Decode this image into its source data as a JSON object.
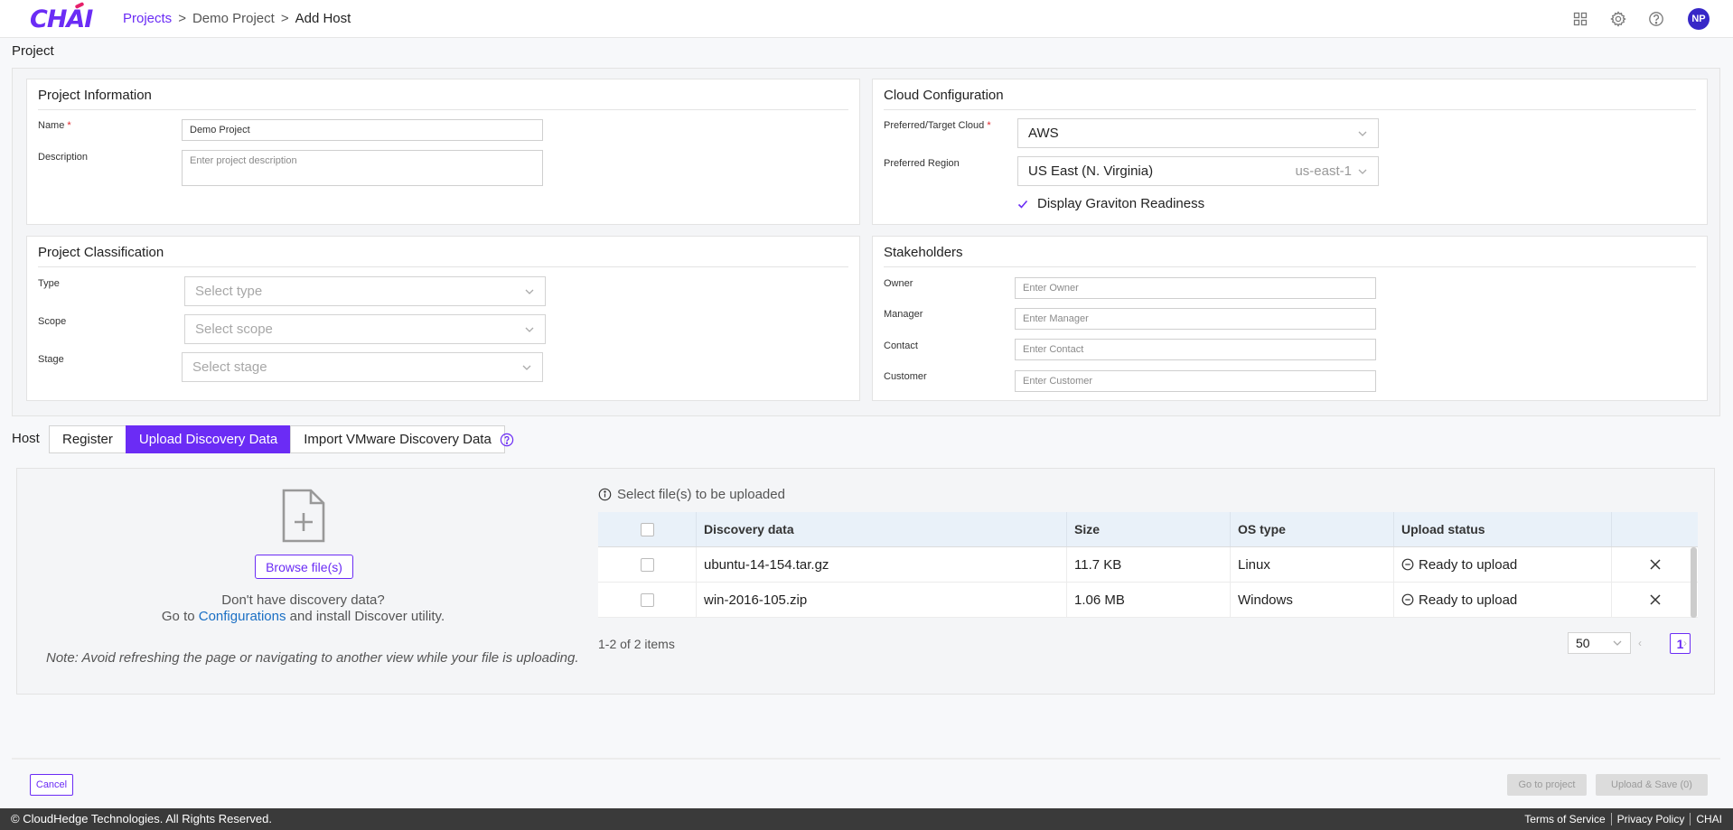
{
  "header": {
    "logo_text": "CHAI",
    "breadcrumb": [
      {
        "label": "Projects"
      },
      {
        "label": "Demo Project"
      },
      {
        "label": "Add Host"
      }
    ],
    "separator": ">",
    "avatar_initials": "NP",
    "icons": [
      "apps-grid-icon",
      "gear-icon",
      "help-circle-icon"
    ]
  },
  "project": {
    "section_title": "Project",
    "info": {
      "title": "Project Information",
      "name_label": "Name",
      "name_value": "Demo Project",
      "description_label": "Description",
      "description_placeholder": "Enter project description"
    },
    "cloud": {
      "title": "Cloud Configuration",
      "cloud_label": "Preferred/Target Cloud",
      "cloud_value": "AWS",
      "region_label": "Preferred Region",
      "region_value": "US East (N. Virginia)",
      "region_code": "us-east-1",
      "graviton_label": "Display Graviton Readiness"
    },
    "classification": {
      "title": "Project Classification",
      "type_label": "Type",
      "type_placeholder": "Select type",
      "scope_label": "Scope",
      "scope_placeholder": "Select scope",
      "stage_label": "Stage",
      "stage_placeholder": "Select stage"
    },
    "stakeholders": {
      "title": "Stakeholders",
      "owner_label": "Owner",
      "owner_placeholder": "Enter Owner",
      "manager_label": "Manager",
      "manager_placeholder": "Enter Manager",
      "contact_label": "Contact",
      "contact_placeholder": "Enter Contact",
      "customer_label": "Customer",
      "customer_placeholder": "Enter Customer"
    }
  },
  "host": {
    "label": "Host",
    "tabs": [
      {
        "label": "Register"
      },
      {
        "label": "Upload Discovery Data"
      },
      {
        "label": "Import VMware Discovery Data"
      }
    ],
    "active_tab": 1
  },
  "upload": {
    "browse_label": "Browse file(s)",
    "nodata_line1": "Don't have discovery data?",
    "nodata_goto": "Go to",
    "nodata_link": "Configurations",
    "nodata_rest": "and install Discover utility.",
    "note": "Note: Avoid refreshing the page or navigating to another view while your file is uploading.",
    "info_text": "Select file(s) to be uploaded",
    "columns": {
      "name": "Discovery data",
      "size": "Size",
      "os": "OS type",
      "status": "Upload status"
    },
    "rows": [
      {
        "name": "ubuntu-14-154.tar.gz",
        "size": "11.7 KB",
        "os": "Linux",
        "status": "Ready to upload"
      },
      {
        "name": "win-2016-105.zip",
        "size": "1.06 MB",
        "os": "Windows",
        "status": "Ready to upload"
      }
    ],
    "count_label": "1-2 of 2 items",
    "page_size": "50",
    "current_page": "1"
  },
  "actions": {
    "cancel": "Cancel",
    "go_to_project": "Go to project",
    "upload_save": "Upload & Save (0)"
  },
  "footer": {
    "copyright": "© CloudHedge Technologies. All Rights Reserved.",
    "terms": "Terms of Service",
    "privacy": "Privacy Policy",
    "brand": "CHAI"
  },
  "colors": {
    "accent": "#6b2cf5",
    "link": "#1a6fc4",
    "required": "#e0262b",
    "avatar": "#3727c7",
    "footer_bg": "#3a3a3a",
    "table_header_bg": "#e9f1f9"
  }
}
